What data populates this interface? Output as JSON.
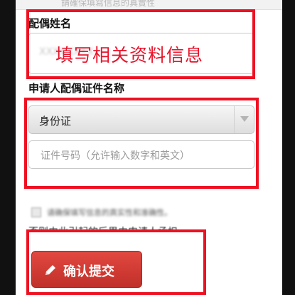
{
  "header": {
    "strip_text": "請確保填寫信息的真實性"
  },
  "form": {
    "spouse_name_label": "配偶姓名",
    "spouse_name_value": "XXXXXXXX",
    "cert_label": "申请人配偶证件名称",
    "cert_type_selected": "身份证",
    "cert_number_placeholder": "证件号码（允许输入数字和英文）",
    "agree_text": "请确保填写信息的真实性和准确性。",
    "agree_text_line2": "否则由此引起的后果由申请人承担。",
    "submit_label": "确认提交"
  },
  "overlay": {
    "instruction_text": "填写相关资料信息"
  },
  "colors": {
    "annotation_red": "#ee1122",
    "button_red": "#d23a33"
  },
  "icons": {
    "submit": "pencil-icon",
    "select": "dropdown-arrow-icon"
  }
}
